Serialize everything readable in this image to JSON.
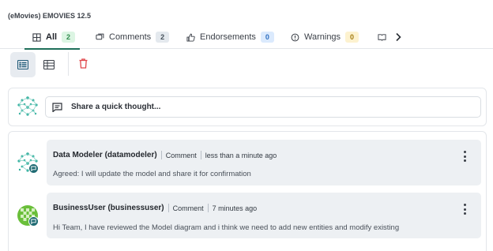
{
  "header": {
    "title": "(eMovies) EMOVIES 12.5"
  },
  "tabs": [
    {
      "label": "All",
      "count": "2",
      "icon": "grid-icon",
      "active": true
    },
    {
      "label": "Comments",
      "count": "2",
      "icon": "comments-icon"
    },
    {
      "label": "Endorsements",
      "count": "0",
      "icon": "thumbs-up-icon"
    },
    {
      "label": "Warnings",
      "count": "0",
      "icon": "warning-icon"
    }
  ],
  "composer": {
    "placeholder": "Share a quick thought..."
  },
  "comments": [
    {
      "author": "Data Modeler (datamodeler)",
      "type": "Comment",
      "time": "less than a minute ago",
      "text": "Agreed: I will update the model and share it for confirmation"
    },
    {
      "author": "BusinessUser (businessuser)",
      "type": "Comment",
      "time": "7 minutes ago",
      "text": "Hi Team, I have reviewed the Model diagram and i think we need to add new entities and modify existing"
    }
  ],
  "colors": {
    "accent": "#1f6f5a",
    "delete": "#e0464a",
    "badge_all": "#dcf5e3",
    "badge_endorse": "#dbeafd",
    "badge_warn": "#fdf2cf"
  }
}
